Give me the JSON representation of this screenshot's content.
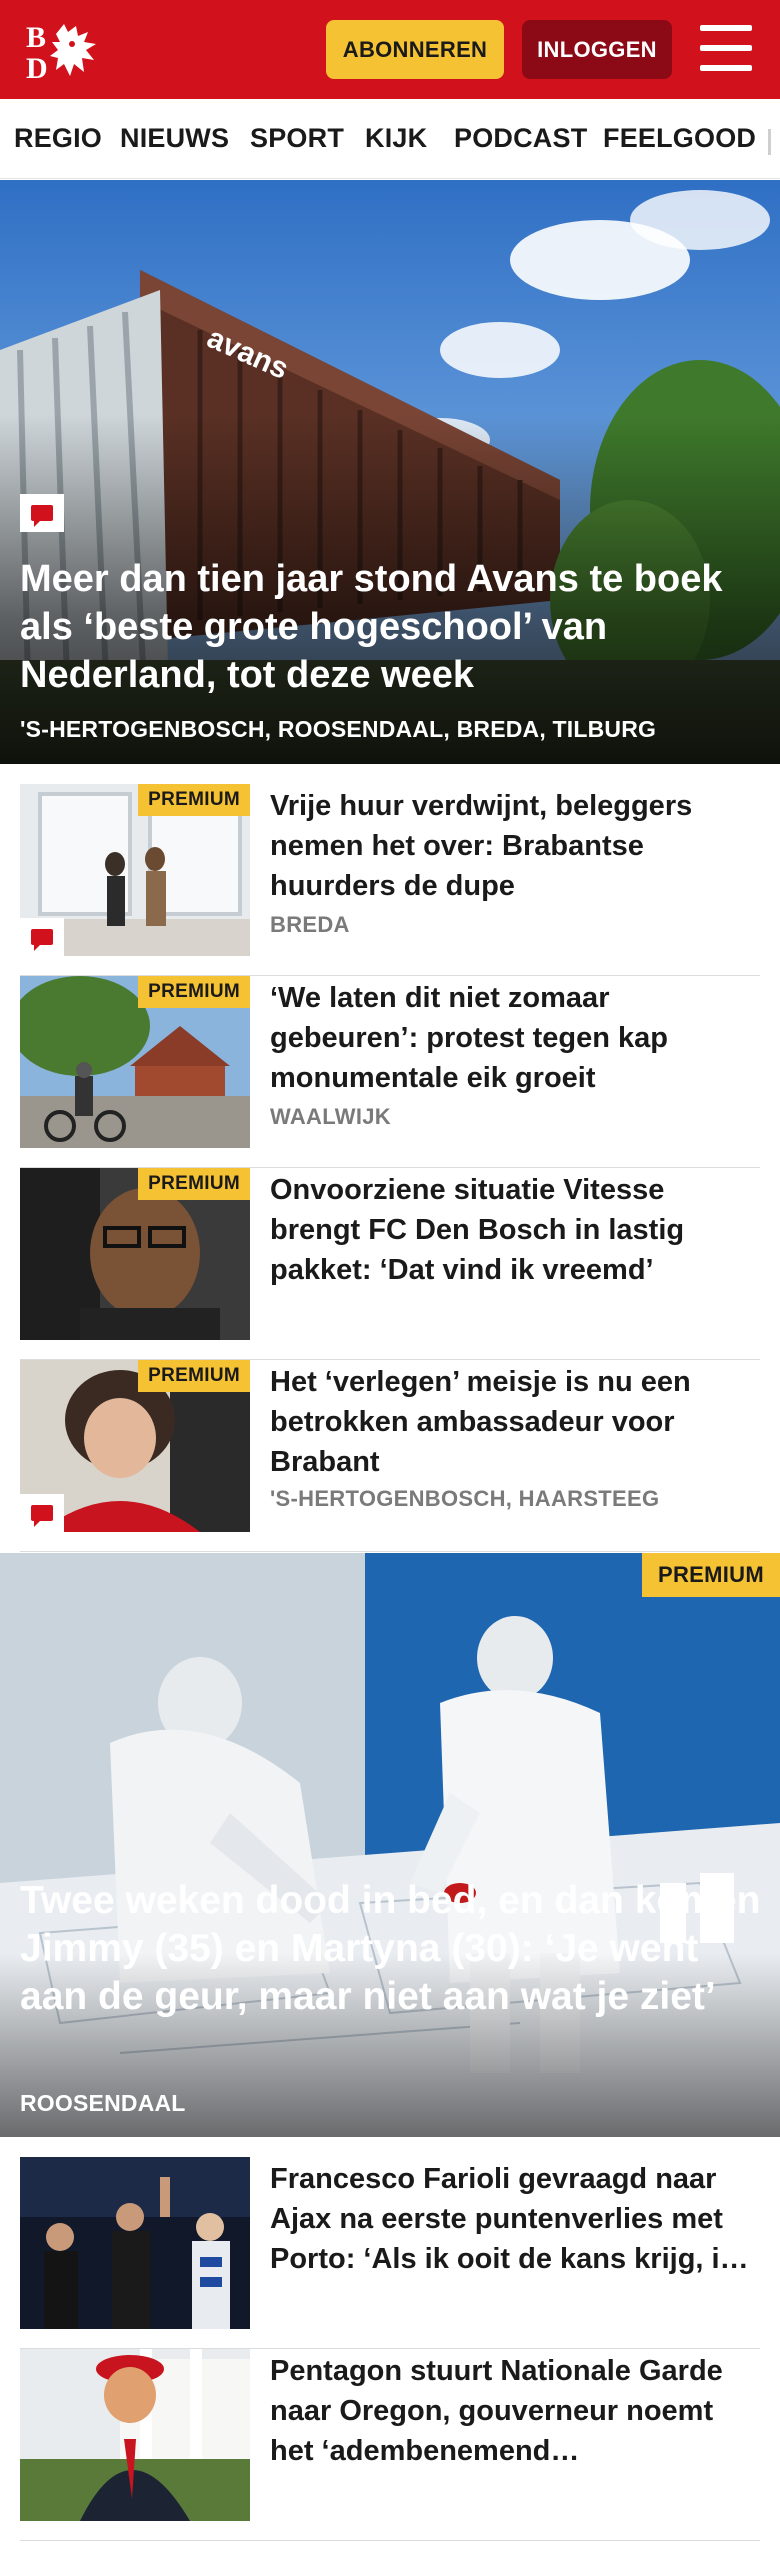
{
  "header": {
    "logo_text": "BD",
    "subscribe_label": "ABONNEREN",
    "login_label": "INLOGGEN"
  },
  "nav": {
    "items": [
      "REGIO",
      "NIEUWS",
      "SPORT",
      "KIJK",
      "PODCAST",
      "FEELGOOD"
    ]
  },
  "hero": {
    "title": "Meer dan tien jaar stond Avans te boek als ‘beste grote hogeschool’ van Nederland, tot deze week",
    "location": "'S-HERTOGENBOSCH, ROOSENDAAL, BREDA, TILBURG",
    "sign_text": "avans"
  },
  "articles": [
    {
      "title": "Vrije huur verdwijnt, beleggers nemen het over: Brabantse huurders de dupe",
      "location": "BREDA",
      "premium": "PREMIUM"
    },
    {
      "title": "‘We laten dit niet zomaar gebeuren’: protest tegen kap monumentale eik groeit",
      "location": "WAALWIJK",
      "premium": "PREMIUM"
    },
    {
      "title": "Onvoorziene situatie Vitesse brengt FC Den Bosch in lastig pakket: ‘Dat vind ik vreemd’",
      "location": "",
      "premium": "PREMIUM"
    },
    {
      "title": "Het ‘verlegen’ meisje is nu een betrokken ambassadeur voor Brabant",
      "location": "'S-HERTOGENBOSCH, HAARSTEEG",
      "premium": "PREMIUM"
    }
  ],
  "feature": {
    "premium": "PREMIUM",
    "title": "Twee weken dood in bed, en dan komen Jimmy (35) en Martyna (30): ‘Je went aan de geur, maar niet aan wat je ziet’",
    "location": "ROOSENDAAL"
  },
  "more_articles": [
    {
      "title": "Francesco Farioli gevraagd naar Ajax na eerste puntenverlies met Porto: ‘Als ik ooit de kans krijg, ik zou het graag doen’"
    },
    {
      "title": "Pentagon stuurt Nationale Garde naar Oregon, gouverneur noemt het ‘adembenemend machtsmisbruik’"
    }
  ],
  "colors": {
    "brand_red": "#d1121c",
    "premium_yellow": "#f5c233",
    "login_dark_red": "#8c0a16"
  },
  "icons": {
    "menu": "hamburger-icon",
    "comment": "comment-icon",
    "logo": "bd-lion-logo"
  }
}
